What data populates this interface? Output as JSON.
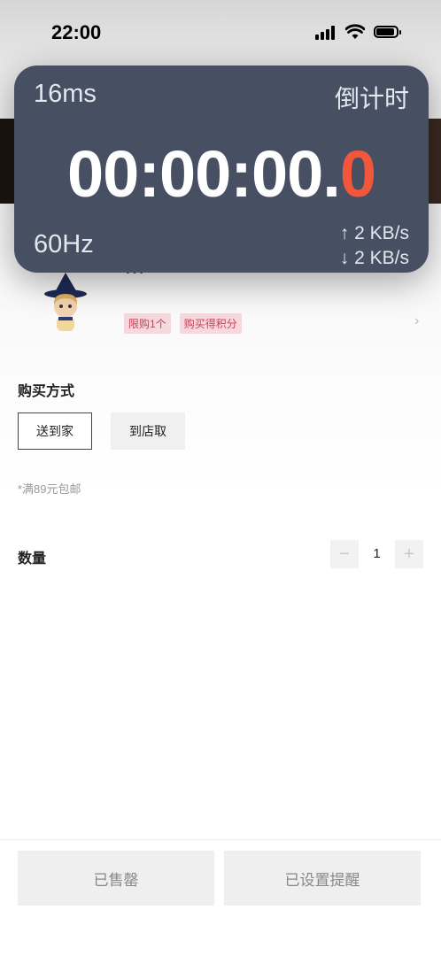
{
  "status_bar": {
    "time": "22:00"
  },
  "overlay": {
    "ms": "16ms",
    "mode": "倒计时",
    "clock_main": "00:00:00.",
    "clock_frac": "0",
    "refresh": "60Hz",
    "upload": "↑ 2 KB/s",
    "download": "↓ 2 KB/s"
  },
  "product": {
    "name_partial": "…",
    "tags": [
      "限购1个",
      "购买得积分"
    ]
  },
  "purchase": {
    "label": "购买方式",
    "options": [
      "送到家",
      "到店取"
    ],
    "selected": "送到家",
    "note": "*满89元包邮"
  },
  "quantity": {
    "label": "数量",
    "value": "1",
    "minus": "−",
    "plus": "+"
  },
  "footer": {
    "sold_out": "已售罄",
    "reminder": "已设置提醒"
  },
  "colors": {
    "overlay_bg": "#465062",
    "accent_red": "#f2573c",
    "tag_bg": "#f6d9de",
    "tag_text": "#c44155"
  }
}
